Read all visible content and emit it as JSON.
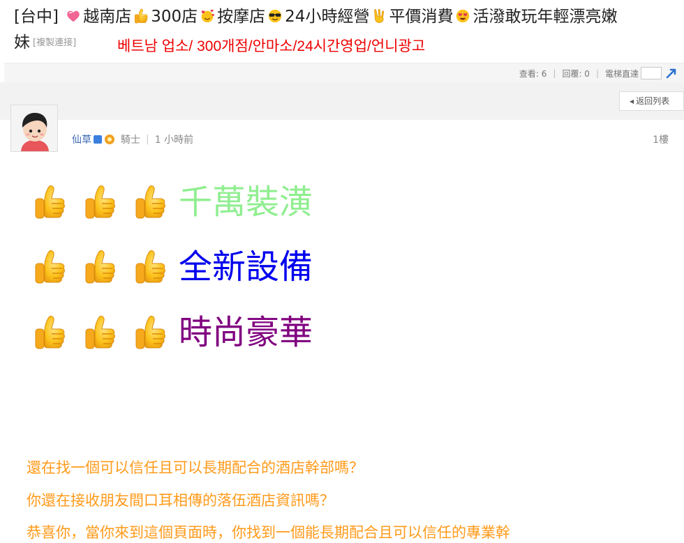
{
  "thread": {
    "title_line1": [
      "[台中]",
      "越南店",
      "300店",
      "按摩店",
      "24小時經營",
      "平價消費",
      "活潑敢玩年輕漂亮嫩"
    ],
    "title_line2": "妹",
    "copy_link": "[複製連接]",
    "korean_caption": "베트남 업소/ 300개점/안마소/24시간영업/언니광고",
    "icons": [
      "pink-heart-icon",
      "thumbs-up-icon",
      "smiling-face-hearts-icon",
      "sunglasses-face-icon",
      "victory-hand-icon",
      "heart-eyes-face-icon"
    ]
  },
  "stats": {
    "views": "查看: 6",
    "replies": "回覆: 0",
    "jump_label": "電梯直達"
  },
  "nav": {
    "back_label": "返回列表"
  },
  "post": {
    "author": "仙草",
    "rank": "騎士",
    "time": "1 小時前",
    "floor": "1樓",
    "lines": [
      {
        "text": "千萬裝潢",
        "color": "#90ee90"
      },
      {
        "text": "全新設備",
        "color": "#0000ee"
      },
      {
        "text": "時尚豪華",
        "color": "#800080"
      }
    ],
    "body": [
      "還在找一個可以信任且可以長期配合的酒店幹部嗎？",
      "你還在接收朋友間口耳相傳的落伍酒店資訊嗎？",
      "恭喜你，當你來到這個頁面時，你找到一個能長期配合且可以信任的專業幹"
    ],
    "body_color": "#ff9a1a"
  }
}
